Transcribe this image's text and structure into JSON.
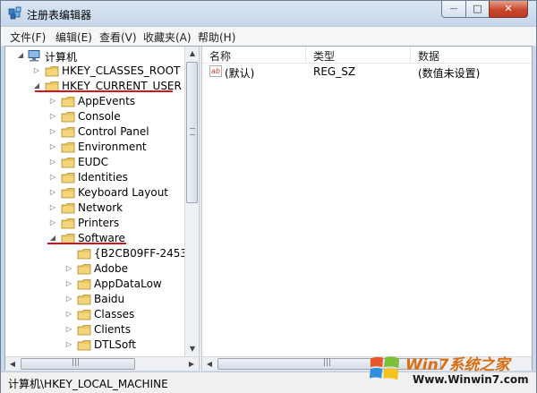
{
  "window": {
    "title": "注册表编辑器",
    "controls": {
      "min": "—",
      "max": "□",
      "close": "✕"
    }
  },
  "menu": [
    {
      "label": "文件(F)"
    },
    {
      "label": "编辑(E)"
    },
    {
      "label": "查看(V)"
    },
    {
      "label": "收藏夹(A)"
    },
    {
      "label": "帮助(H)"
    }
  ],
  "tree": {
    "root": "计算机",
    "hives": [
      "HKEY_CLASSES_ROOT",
      "HKEY_CURRENT_USER"
    ],
    "current_user_children": [
      "AppEvents",
      "Console",
      "Control Panel",
      "Environment",
      "EUDC",
      "Identities",
      "Keyboard Layout",
      "Network",
      "Printers",
      "Software"
    ],
    "software_children": [
      "{B2CB09FF-2453-",
      "Adobe",
      "AppDataLow",
      "Baidu",
      "Classes",
      "Clients",
      "DTLSoft"
    ]
  },
  "list": {
    "columns": [
      "名称",
      "类型",
      "数据"
    ],
    "rows": [
      {
        "name": "(默认)",
        "type": "REG_SZ",
        "data": "(数值未设置)"
      }
    ]
  },
  "scrollbars": {
    "grip": "|||"
  },
  "status": {
    "path": "计算机\\HKEY_LOCAL_MACHINE"
  },
  "watermark": {
    "brand": "Win7系统之家",
    "url": "Www.Winwin7.com"
  },
  "colors": {
    "highlight_underline": "#d2141e",
    "folder": "#e8c25a",
    "close_button": "#c9482d"
  }
}
